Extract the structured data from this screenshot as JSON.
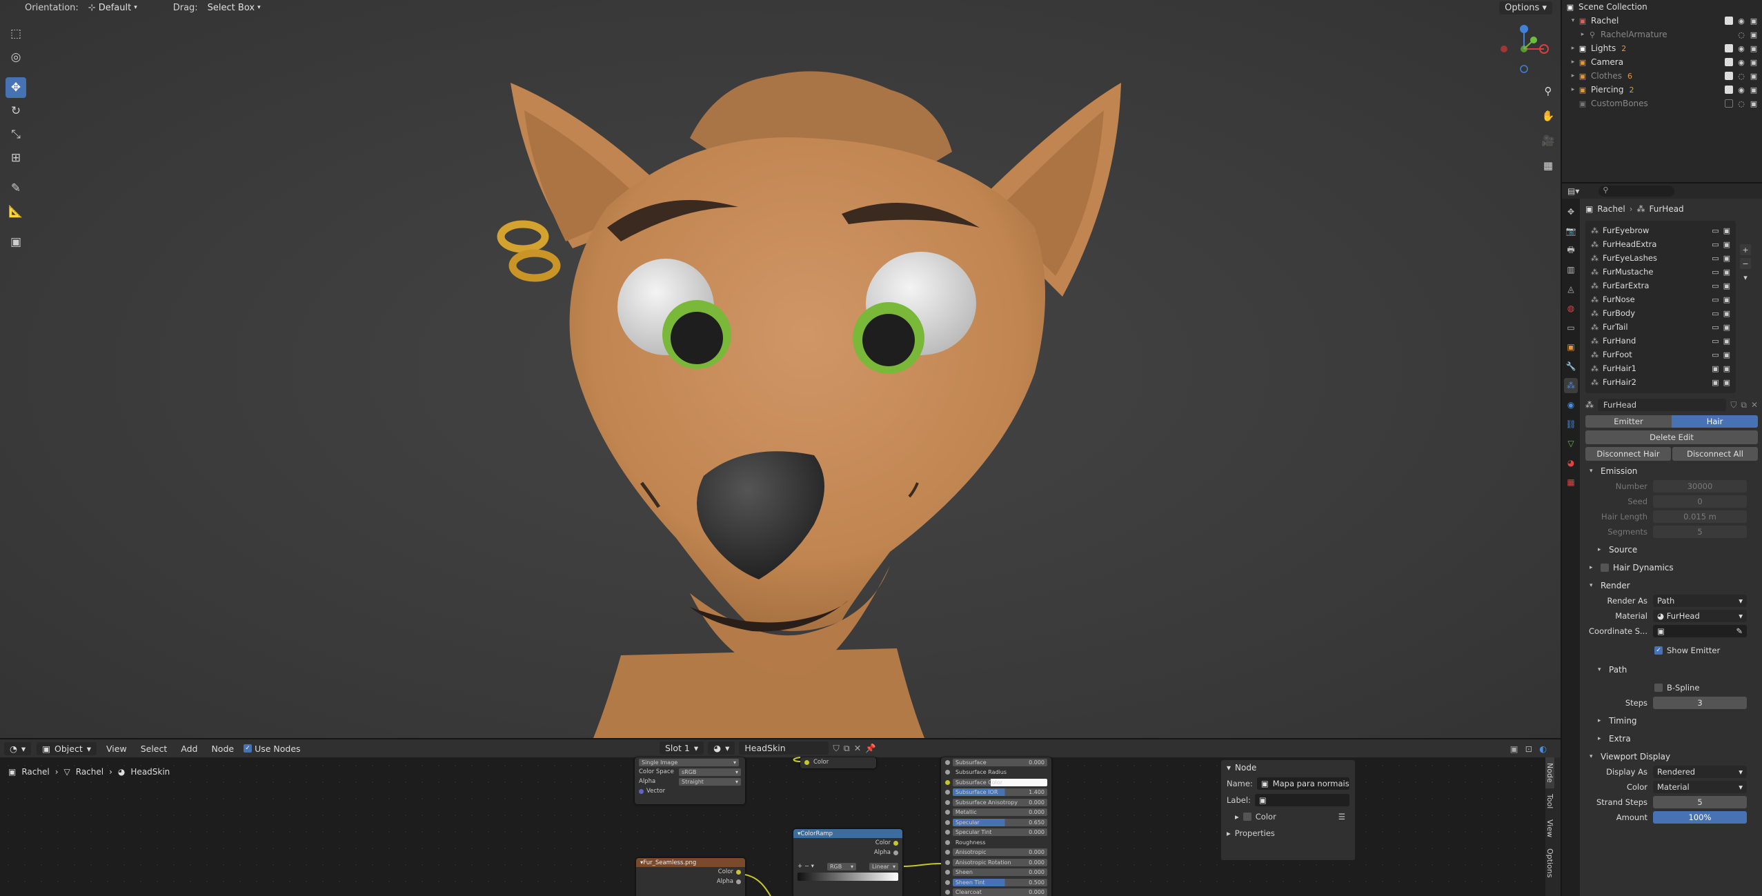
{
  "viewport": {
    "orientation_label": "Orientation:",
    "orientation_value": "Default",
    "drag_label": "Drag:",
    "drag_value": "Select Box",
    "options_label": "Options"
  },
  "outliner": {
    "items": [
      {
        "name": "Scene Collection",
        "icon": "collection-icon",
        "dim": false,
        "indent": 0
      },
      {
        "name": "Rachel",
        "icon": "collection-icon",
        "dim": false,
        "indent": 1
      },
      {
        "name": "RachelArmature",
        "icon": "armature-icon",
        "dim": true,
        "indent": 2
      },
      {
        "name": "Lights",
        "icon": "collection-icon",
        "dim": false,
        "indent": 1,
        "badge": "2"
      },
      {
        "name": "Camera",
        "icon": "collection-icon",
        "dim": false,
        "indent": 1
      },
      {
        "name": "Clothes",
        "icon": "collection-icon",
        "dim": true,
        "indent": 1,
        "badge": "6"
      },
      {
        "name": "Piercing",
        "icon": "collection-icon",
        "dim": false,
        "indent": 1,
        "badge": "2"
      },
      {
        "name": "CustomBones",
        "icon": "collection-icon",
        "dim": true,
        "indent": 1
      }
    ]
  },
  "properties": {
    "breadcrumb": {
      "object": "Rachel",
      "system": "FurHead"
    },
    "particle_systems": [
      "FurEyebrow",
      "FurHeadExtra",
      "FurEyeLashes",
      "FurMustache",
      "FurEarExtra",
      "FurNose",
      "FurBody",
      "FurTail",
      "FurHand",
      "FurFoot",
      "FurHair1",
      "FurHair2"
    ],
    "settings_name": "FurHead",
    "type_tabs": [
      "Emitter",
      "Hair"
    ],
    "active_type": "Hair",
    "delete_edit": "Delete Edit",
    "disconnect_hair": "Disconnect Hair",
    "disconnect_all": "Disconnect All",
    "emission": {
      "title": "Emission",
      "number_label": "Number",
      "number": "30000",
      "seed_label": "Seed",
      "seed": "0",
      "hair_length_label": "Hair Length",
      "hair_length": "0.015 m",
      "segments_label": "Segments",
      "segments": "5"
    },
    "source_title": "Source",
    "hair_dynamics_title": "Hair Dynamics",
    "render": {
      "title": "Render",
      "render_as_label": "Render As",
      "render_as": "Path",
      "material_label": "Material",
      "material": "FurHead",
      "coordinate_label": "Coordinate S...",
      "show_emitter": "Show Emitter"
    },
    "path": {
      "title": "Path",
      "bspline": "B-Spline",
      "steps_label": "Steps",
      "steps": "3"
    },
    "timing_title": "Timing",
    "extra_title": "Extra",
    "viewport_display": {
      "title": "Viewport Display",
      "display_as_label": "Display As",
      "display_as": "Rendered",
      "color_label": "Color",
      "color": "Material",
      "strand_steps_label": "Strand Steps",
      "strand_steps": "5",
      "amount_label": "Amount",
      "amount": "100%"
    }
  },
  "node_editor": {
    "mode": "Object",
    "menus": [
      "View",
      "Select",
      "Add",
      "Node"
    ],
    "use_nodes": "Use Nodes",
    "slot": "Slot 1",
    "material": "HeadSkin",
    "breadcrumb": [
      "Rachel",
      "Rachel",
      "HeadSkin"
    ],
    "image_node": {
      "projection": "Single Image",
      "color_space_label": "Color Space",
      "color_space": "sRGB",
      "alpha_label": "Alpha",
      "alpha": "Straight",
      "vector": "Vector"
    },
    "tex_node": {
      "title": "Fur_Seamless.png",
      "out_color": "Color",
      "out_alpha": "Alpha"
    },
    "color_out": "Color",
    "ramp": {
      "title": "ColorRamp",
      "out_color": "Color",
      "out_alpha": "Alpha",
      "mode": "RGB",
      "interp": "Linear"
    },
    "bsdf_inputs": [
      {
        "name": "Subsurface",
        "value": "0.000"
      },
      {
        "name": "Subsurface Radius",
        "value": ""
      },
      {
        "name": "Subsurface Color",
        "value": ""
      },
      {
        "name": "Subsurface IOR",
        "value": "1.400"
      },
      {
        "name": "Subsurface Anisotropy",
        "value": "0.000"
      },
      {
        "name": "Metallic",
        "value": "0.000"
      },
      {
        "name": "Specular",
        "value": "0.650"
      },
      {
        "name": "Specular Tint",
        "value": "0.000"
      },
      {
        "name": "Roughness",
        "value": ""
      },
      {
        "name": "Anisotropic",
        "value": "0.000"
      },
      {
        "name": "Anisotropic Rotation",
        "value": "0.000"
      },
      {
        "name": "Sheen",
        "value": "0.000"
      },
      {
        "name": "Sheen Tint",
        "value": "0.500"
      },
      {
        "name": "Clearcoat",
        "value": "0.000"
      }
    ],
    "node_panel": {
      "title": "Node",
      "name_label": "Name:",
      "name_value": "Mapa para normais",
      "label_label": "Label:",
      "color_section": "Color",
      "properties_section": "Properties"
    },
    "side_tabs": [
      "Node",
      "Tool",
      "View",
      "Options"
    ]
  },
  "colors": {
    "accent": "#4772b3",
    "skin": "#c48a56",
    "iris": "#7ab83a",
    "gold": "#d4a22e"
  }
}
